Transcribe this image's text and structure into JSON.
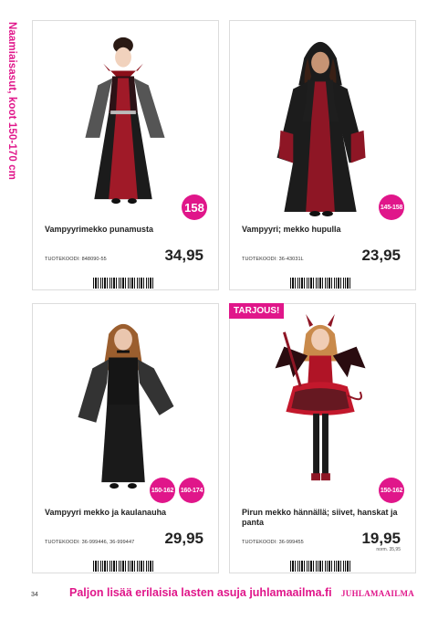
{
  "side_title": "Naamiaisasut, koot 150-170 cm",
  "products": [
    {
      "name": "Vampyyrimekko punamusta",
      "code_label": "TUOTEKOODI: 848090-55",
      "price": "34,95",
      "sizes": [
        "158"
      ]
    },
    {
      "name": "Vampyyri; mekko hupulla",
      "code_label": "TUOTEKOODI: 36-43031L",
      "price": "23,95",
      "sizes": [
        "145-158"
      ]
    },
    {
      "name": "Vampyyri mekko ja kaulanauha",
      "code_label": "TUOTEKOODI: 36-999446, 36-999447",
      "price": "29,95",
      "sizes": [
        "150-162",
        "160-174"
      ]
    },
    {
      "name": "Pirun mekko hännällä; siivet, hanskat ja panta",
      "code_label": "TUOTEKOODI: 36-999455",
      "price": "19,95",
      "normal_price": "norm. 35,95",
      "sizes": [
        "150-162"
      ],
      "offer": "TARJOUS!"
    }
  ],
  "footer": {
    "page_number": "34",
    "text": "Paljon lisää erilaisia lasten asuja juhlamaailma.fi",
    "brand": "JUHLAMAAILMA"
  },
  "colors": {
    "accent": "#e0168a"
  }
}
